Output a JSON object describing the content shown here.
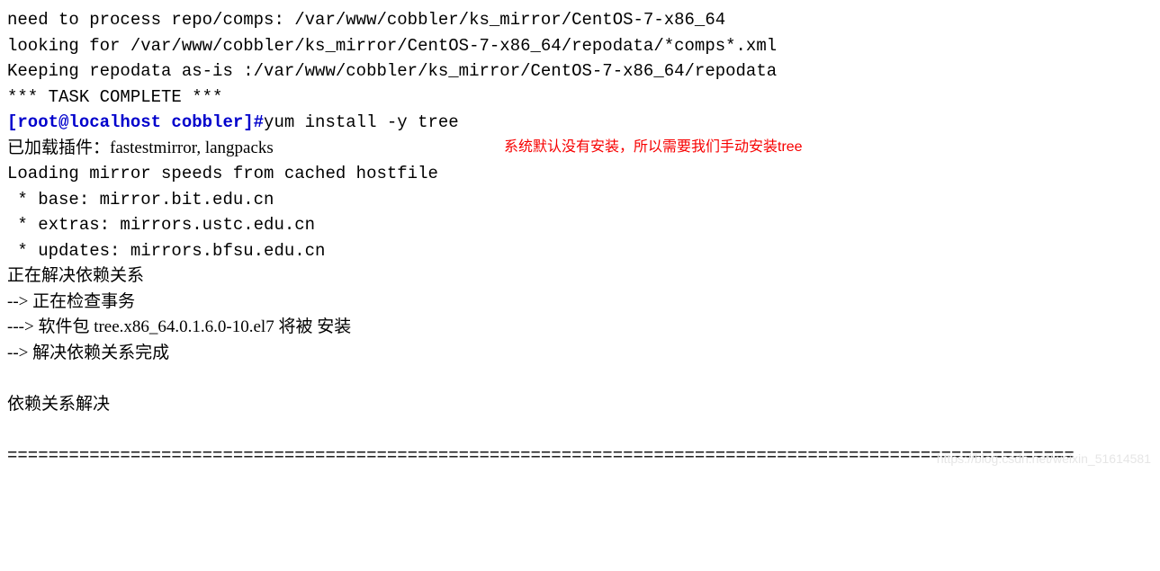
{
  "lines": {
    "l1": "need to process repo/comps: /var/www/cobbler/ks_mirror/CentOS-7-x86_64",
    "l2": "looking for /var/www/cobbler/ks_mirror/CentOS-7-x86_64/repodata/*comps*.xml",
    "l3": "Keeping repodata as-is :/var/www/cobbler/ks_mirror/CentOS-7-x86_64/repodata",
    "l4": "*** TASK COMPLETE ***",
    "prompt": "[root@localhost cobbler]#",
    "cmd": "yum install -y tree",
    "l6": "已加载插件：fastestmirror, langpacks",
    "l7": "Loading mirror speeds from cached hostfile",
    "l8": " * base: mirror.bit.edu.cn",
    "l9": " * extras: mirrors.ustc.edu.cn",
    "l10": " * updates: mirrors.bfsu.edu.cn",
    "l11": "正在解决依赖关系",
    "l12": "--> 正在检查事务",
    "l13": "---> 软件包 tree.x86_64.0.1.6.0-10.el7 将被 安装",
    "l14": "--> 解决依赖关系完成",
    "blank": " ",
    "l15": "依赖关系解决",
    "sep": "========================================================================================================"
  },
  "annotation": "系统默认没有安装，所以需要我们手动安装tree",
  "watermark": "https://blog.csdn.net/weixin_51614581"
}
